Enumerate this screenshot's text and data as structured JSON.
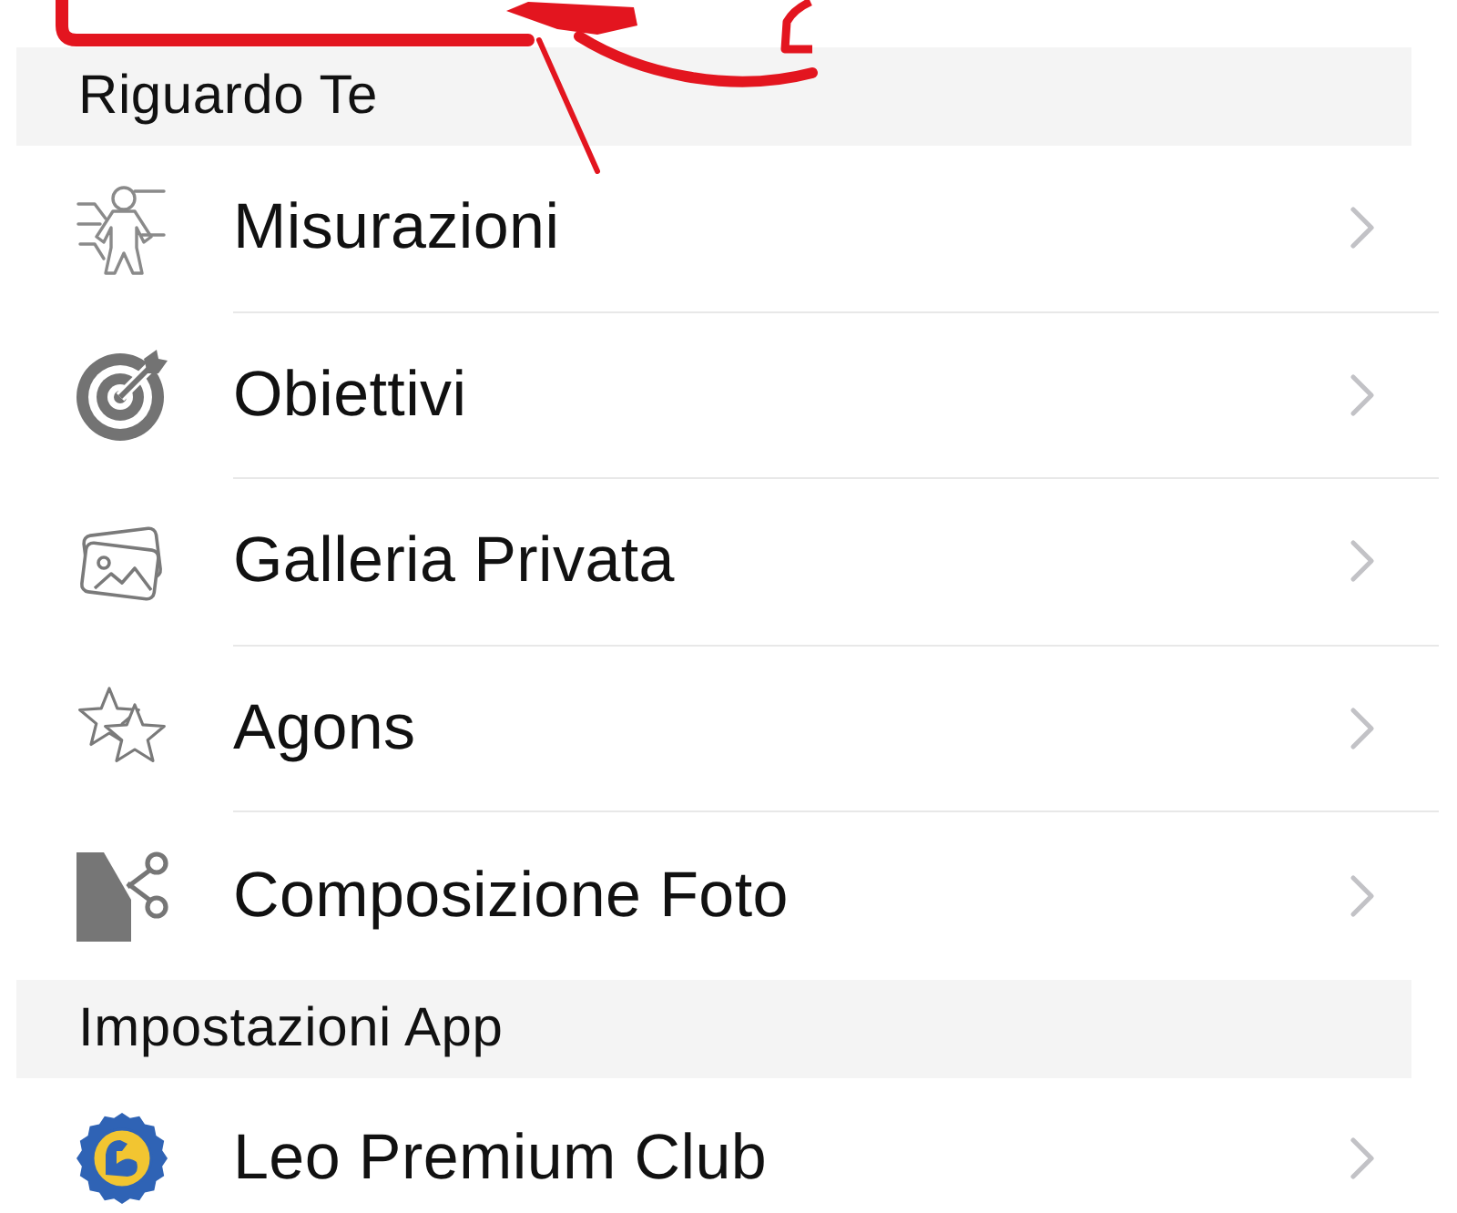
{
  "sections": [
    {
      "title": "Riguardo Te",
      "items": [
        {
          "label": "Misurazioni"
        },
        {
          "label": "Obiettivi"
        },
        {
          "label": "Galleria Privata"
        },
        {
          "label": "Agons"
        },
        {
          "label": "Composizione Foto"
        }
      ]
    },
    {
      "title": "Impostazioni App",
      "items": [
        {
          "label": "Leo Premium Club"
        }
      ]
    }
  ]
}
